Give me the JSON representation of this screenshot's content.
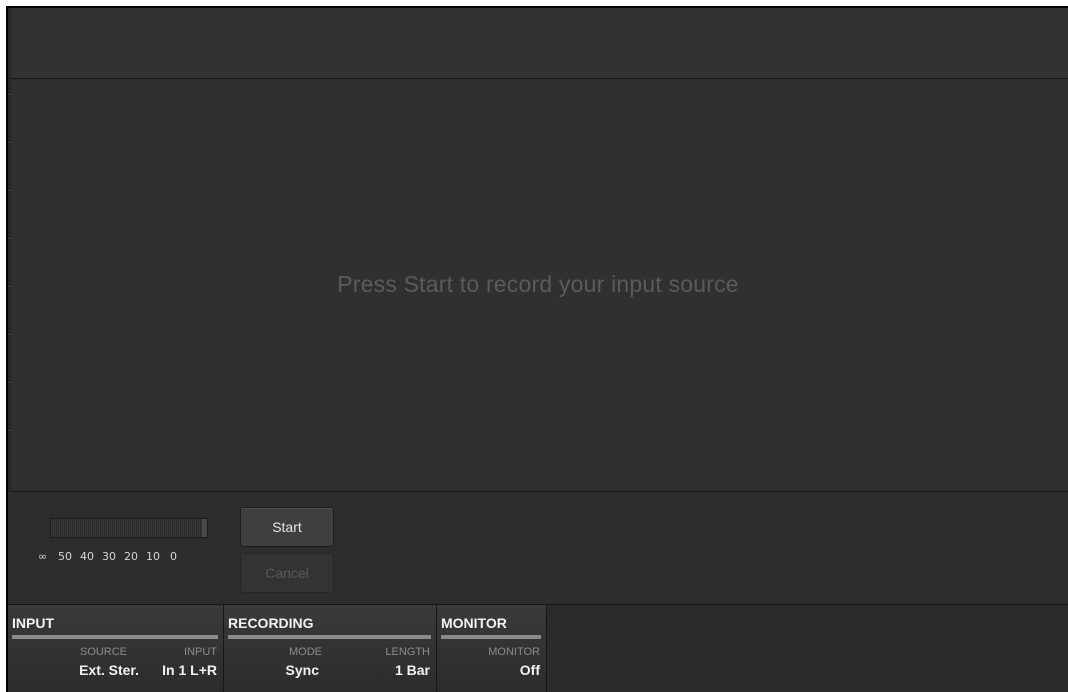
{
  "main": {
    "prompt": "Press Start to record your input source"
  },
  "meter": {
    "scale": [
      "∞",
      "50",
      "40",
      "30",
      "20",
      "10",
      "0"
    ]
  },
  "buttons": {
    "start": "Start",
    "cancel": "Cancel"
  },
  "params": {
    "input": {
      "title": "INPUT",
      "source": {
        "label": "SOURCE",
        "value": "Ext. Ster."
      },
      "input": {
        "label": "INPUT",
        "value": "In 1 L+R"
      }
    },
    "recording": {
      "title": "RECORDING",
      "mode": {
        "label": "MODE",
        "value": "Sync"
      },
      "length": {
        "label": "LENGTH",
        "value": "1 Bar"
      }
    },
    "monitor": {
      "title": "MONITOR",
      "monitor": {
        "label": "MONITOR",
        "value": "Off"
      }
    }
  }
}
